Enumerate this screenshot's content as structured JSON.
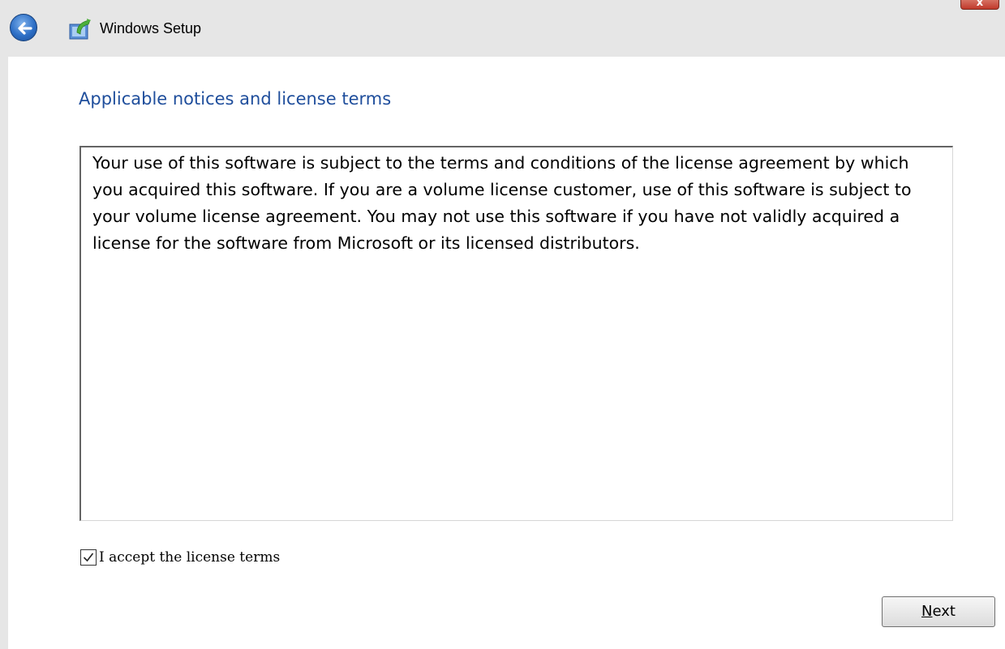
{
  "window": {
    "title": "Windows Setup"
  },
  "page": {
    "heading": "Applicable notices and license terms",
    "license_text": "Your use of this software is subject to the terms and conditions of the license agreement by which you acquired this software.  If you are a volume license customer, use of this software is subject to your volume license agreement.  You may not use this software if you have not validly acquired a license for the software from Microsoft or its licensed distributors."
  },
  "accept": {
    "label": "I accept the license terms",
    "checked": true
  },
  "buttons": {
    "next_mnemonic": "N",
    "next_rest": "ext",
    "close_glyph": "x"
  },
  "colors": {
    "heading": "#1f4e9c",
    "titlebar": "#e6e6e6",
    "close": "#c0392b"
  },
  "icons": {
    "back": "back-arrow-icon",
    "setup": "windows-setup-icon",
    "check": "checkmark-icon",
    "close": "close-icon"
  }
}
